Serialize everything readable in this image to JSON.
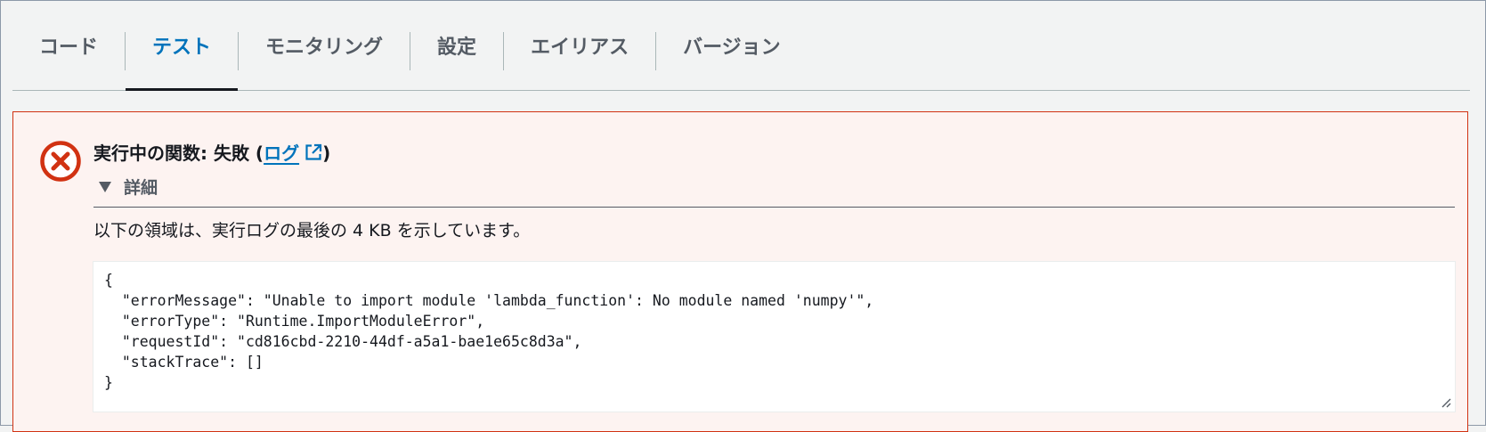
{
  "tabs": [
    {
      "label": "コード",
      "active": false
    },
    {
      "label": "テスト",
      "active": true
    },
    {
      "label": "モニタリング",
      "active": false
    },
    {
      "label": "設定",
      "active": false
    },
    {
      "label": "エイリアス",
      "active": false
    },
    {
      "label": "バージョン",
      "active": false
    }
  ],
  "alert": {
    "status": "error",
    "icon": "error-circle-x-icon",
    "title_prefix": "実行中の関数: 失敗 (",
    "log_link": "ログ",
    "link_icon": "external-link-icon",
    "title_suffix": ")",
    "details_label": "詳細",
    "description": "以下の領域は、実行ログの最後の 4 KB を示しています。",
    "log_lines": [
      "{",
      "  \"errorMessage\": \"Unable to import module 'lambda_function': No module named 'numpy'\",",
      "  \"errorType\": \"Runtime.ImportModuleError\",",
      "  \"requestId\": \"cd816cbd-2210-44df-a5a1-bae1e65c8d3a\",",
      "  \"stackTrace\": []",
      "}"
    ]
  },
  "colors": {
    "accent": "#0073bb",
    "error": "#d13212",
    "error_bg": "#fdf3f1",
    "page_bg": "#f2f3f3",
    "text": "#16191f",
    "muted": "#545b64"
  }
}
